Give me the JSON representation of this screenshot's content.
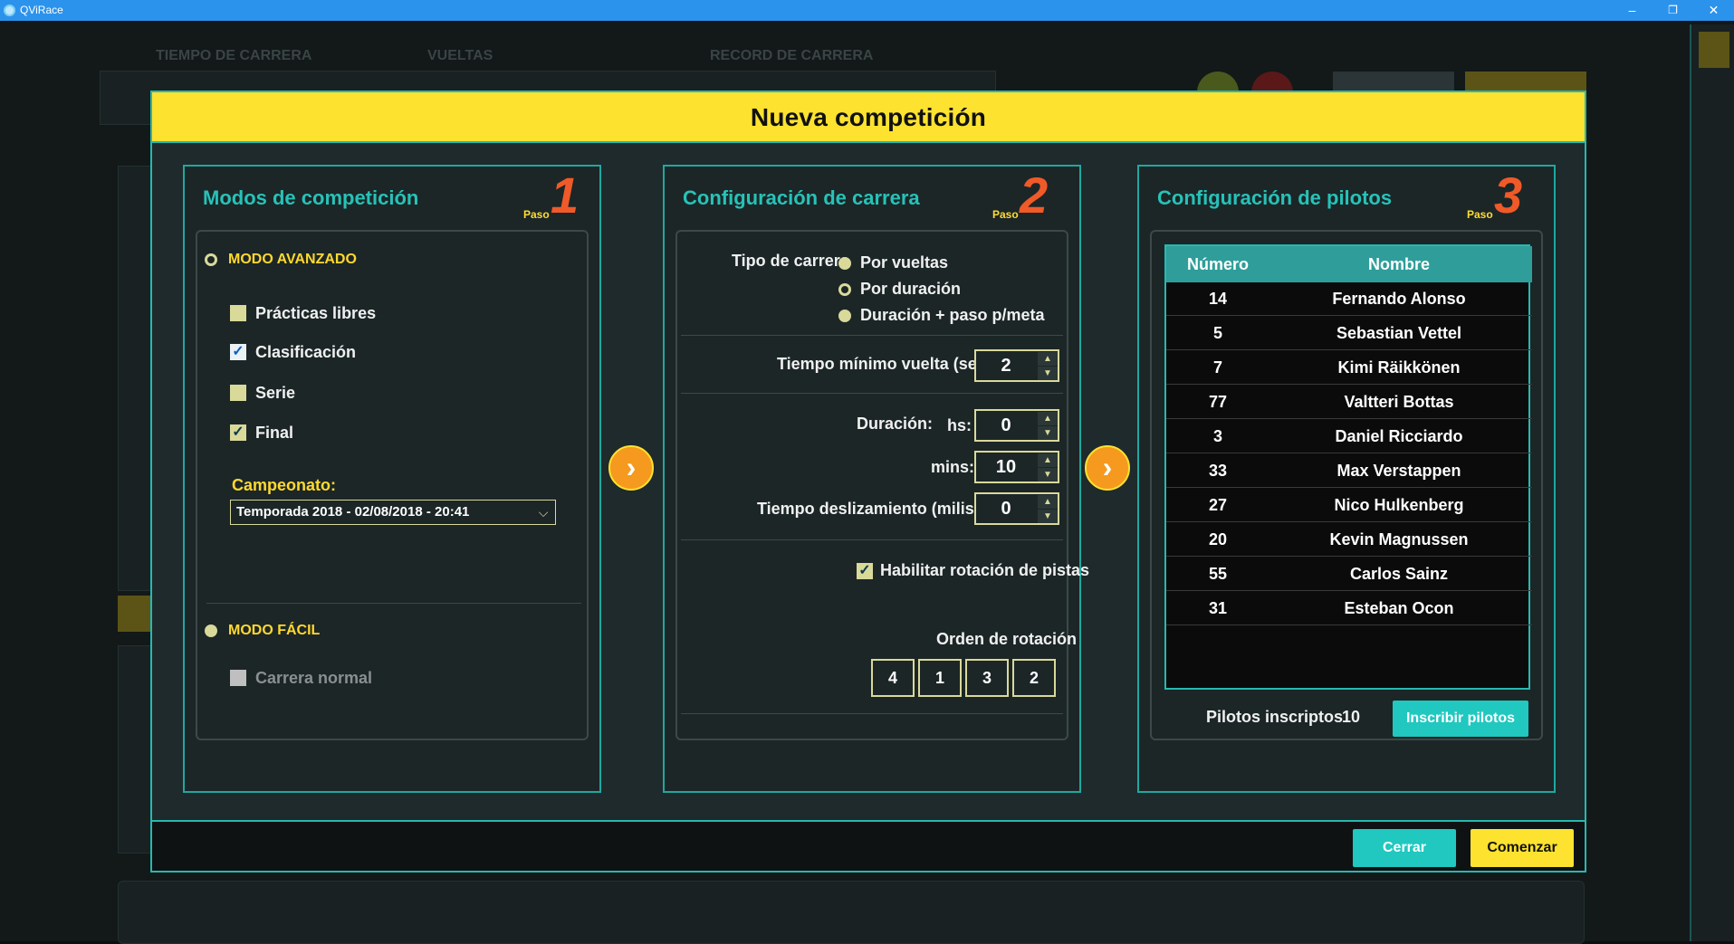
{
  "window": {
    "title": "QViRace",
    "minimize": "–",
    "restore": "❐",
    "close": "✕"
  },
  "background": {
    "tabs": [
      "TIEMPO DE CARRERA",
      "VUELTAS",
      "RECORD DE CARRERA"
    ]
  },
  "modal": {
    "title": "Nueva competición",
    "paso_label": "Paso",
    "panel1": {
      "title": "Modos de competición",
      "step": "1",
      "advanced_label": "MODO AVANZADO",
      "options": [
        {
          "label": "Prácticas libres",
          "checked": ""
        },
        {
          "label": "Clasificación",
          "checked": "✓"
        },
        {
          "label": "Serie",
          "checked": ""
        },
        {
          "label": "Final",
          "checked": "✓"
        }
      ],
      "championship_label": "Campeonato:",
      "championship_value": "Temporada 2018 - 02/08/2018 - 20:41",
      "easy_label": "MODO FÁCIL",
      "easy_option": "Carrera normal"
    },
    "panel2": {
      "title": "Configuración de carrera",
      "step": "2",
      "race_type_label": "Tipo de carrera",
      "race_types": [
        "Por vueltas",
        "Por duración",
        "Duración + paso p/meta"
      ],
      "min_lap_label": "Tiempo mínimo vuelta (seg.):",
      "min_lap_value": "2",
      "duration_label": "Duración:",
      "hs_label": "hs:",
      "hs_value": "0",
      "mins_label": "mins:",
      "mins_value": "10",
      "slide_label": "Tiempo deslizamiento (miliseg.):",
      "slide_value": "0",
      "rotation_label": "Habilitar rotación de pistas",
      "rotation_checked": "✓",
      "order_label": "Orden de rotación",
      "order": [
        "4",
        "1",
        "3",
        "2"
      ]
    },
    "panel3": {
      "title": "Configuración de pilotos",
      "step": "3",
      "headers": {
        "number": "Número",
        "name": "Nombre"
      },
      "pilots": [
        {
          "number": "14",
          "name": "Fernando Alonso"
        },
        {
          "number": "5",
          "name": "Sebastian Vettel"
        },
        {
          "number": "7",
          "name": "Kimi Räikkönen"
        },
        {
          "number": "77",
          "name": "Valtteri Bottas"
        },
        {
          "number": "3",
          "name": "Daniel Ricciardo"
        },
        {
          "number": "33",
          "name": "Max Verstappen"
        },
        {
          "number": "27",
          "name": "Nico Hulkenberg"
        },
        {
          "number": "20",
          "name": "Kevin Magnussen"
        },
        {
          "number": "55",
          "name": "Carlos Sainz"
        },
        {
          "number": "31",
          "name": "Esteban Ocon"
        }
      ],
      "enrolled_label": "Pilotos inscriptos",
      "enrolled_count": "10",
      "enroll_button": "Inscribir pilotos"
    },
    "next_arrow": "›",
    "close_button": "Cerrar",
    "start_button": "Comenzar"
  },
  "colors": {
    "accent_yellow": "#fde22f",
    "accent_teal": "#27b8b0",
    "step_orange": "#f05a28"
  }
}
